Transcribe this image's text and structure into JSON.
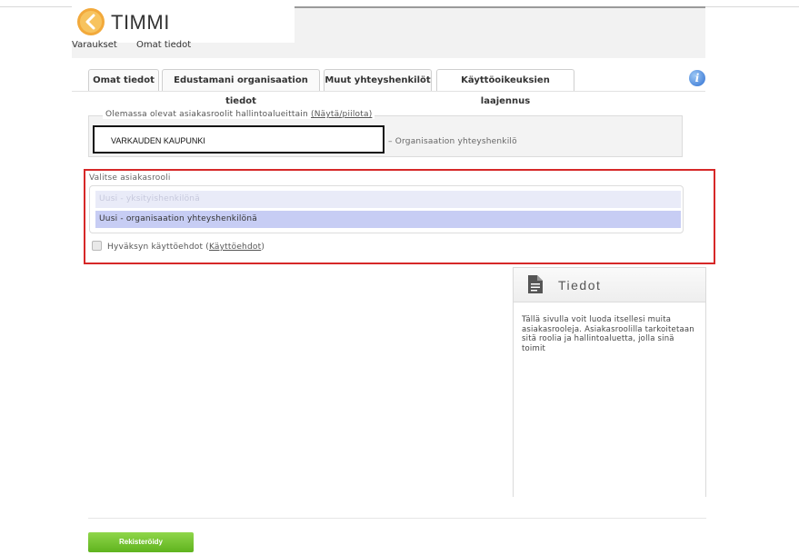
{
  "app": {
    "name": "TIMMI"
  },
  "top_nav": {
    "items": [
      "Varaukset",
      "Omat tiedot"
    ]
  },
  "tabs": [
    {
      "label": "Omat tiedot",
      "active": false
    },
    {
      "label": "Edustamani organisaation tiedot",
      "active": false
    },
    {
      "label": "Muut yhteyshenkilöt",
      "active": false
    },
    {
      "label": "Käyttöoikeuksien laajennus",
      "active": true
    }
  ],
  "existing_roles": {
    "legend": "Olemassa olevat asiakasroolit hallintoalueittain",
    "toggle_link": "(Näytä/piilota)",
    "organization": "VARKAUDEN  KAUPUNKI",
    "role": "Organisaation yhteyshenkilö"
  },
  "choose_role": {
    "legend": "Valitse asiakasrooli",
    "options": [
      {
        "label": "Uusi - yksityishenkilönä",
        "state": "disabled"
      },
      {
        "label": "Uusi - organisaation yhteyshenkilönä",
        "state": "selected"
      }
    ],
    "terms_text": "Hyväksyn käyttöehdot",
    "terms_link": "Käyttöehdot",
    "terms_checked": false
  },
  "info_panel": {
    "title": "Tiedot",
    "text": "Tällä sivulla voit luoda itsellesi muita asiakasrooleja. Asiakasroolilla tarkoitetaan sitä roolia ja hallintoaluetta, jolla sinä toimit"
  },
  "actions": {
    "register_label": "Rekisteröidy"
  },
  "colors": {
    "accent_red": "#d62828",
    "button_green": "#6cc02a",
    "selected_option": "#c7cdf4",
    "info_blue": "#2f6fd1"
  },
  "icons": {
    "logo": "back-arrow-circle-icon",
    "info": "info-icon",
    "panel": "document-icon"
  }
}
